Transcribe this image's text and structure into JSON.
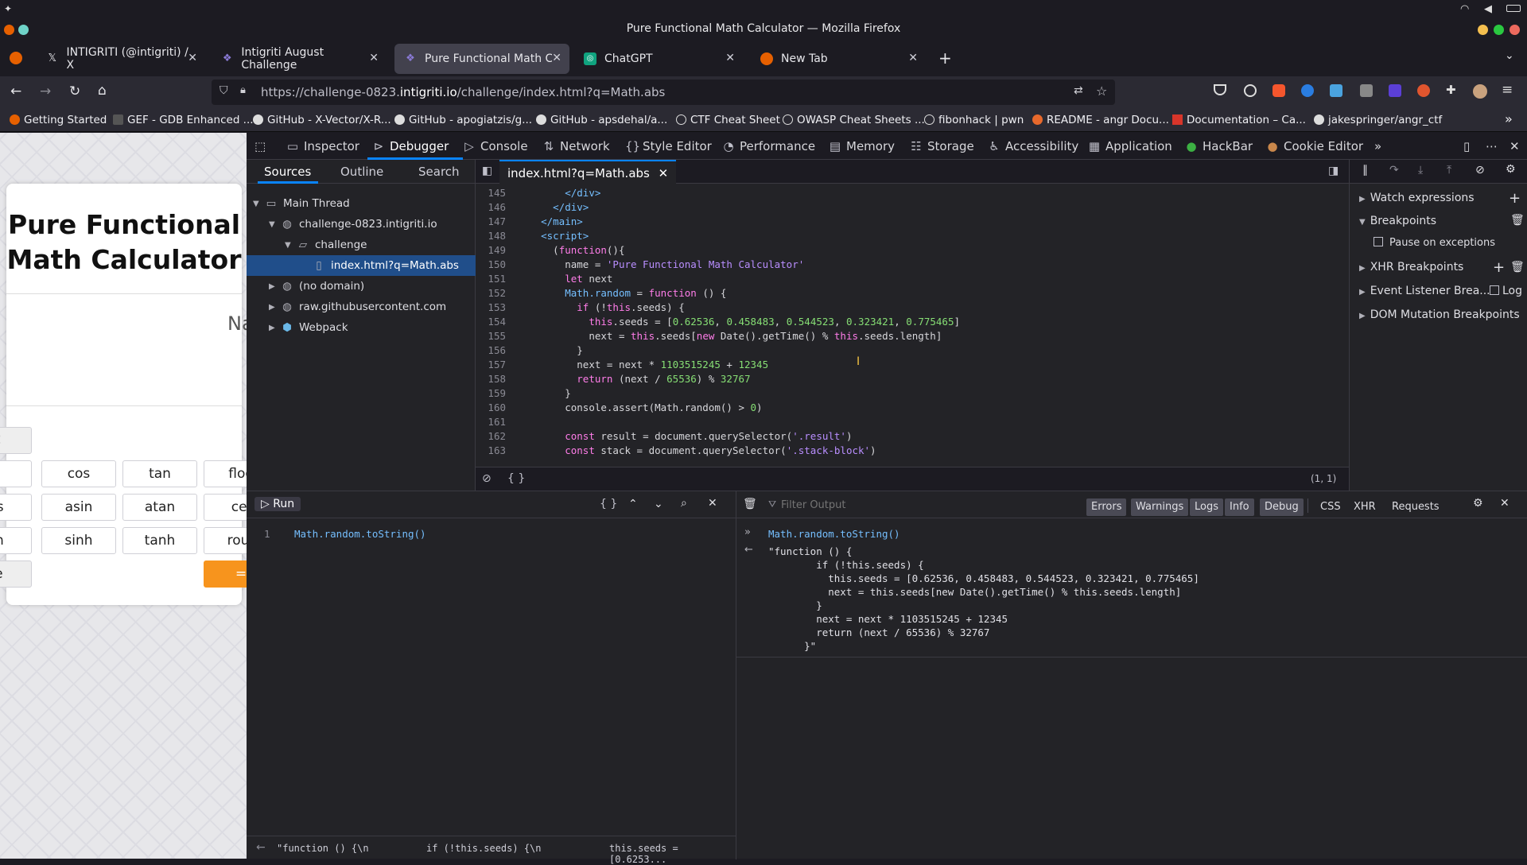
{
  "window": {
    "title": "Pure Functional Math Calculator — Mozilla Firefox"
  },
  "tabs": [
    {
      "label": "INTIGRITI (@intigriti) / X",
      "icon": "x-logo-icon"
    },
    {
      "label": "Intigriti August Challenge",
      "icon": "intigriti-icon"
    },
    {
      "label": "Pure Functional Math Calc",
      "icon": "intigriti-icon",
      "active": true
    },
    {
      "label": "ChatGPT",
      "icon": "chatgpt-icon"
    },
    {
      "label": "New Tab",
      "icon": "firefox-icon"
    }
  ],
  "nav": {
    "url_prefix": "https://challenge-0823.",
    "url_domain": "intigriti.io",
    "url_path": "/challenge/index.html?q=Math.abs"
  },
  "bookmarks": [
    "Getting Started",
    "GEF - GDB Enhanced ...",
    "GitHub - X-Vector/X-R...",
    "GitHub - apogiatzis/g...",
    "GitHub - apsdehal/a...",
    "CTF Cheat Sheet",
    "OWASP Cheat Sheets ...",
    "fibonhack | pwn",
    "README - angr Docu...",
    "Documentation – Ca...",
    "jakespringer/angr_ctf"
  ],
  "page": {
    "title_line1": "Pure Functional",
    "title_line2": "Math Calculator",
    "partial_label": "Na",
    "buttons": [
      [
        "n",
        "cos",
        "tan",
        "floo"
      ],
      [
        "os",
        "asin",
        "atan",
        "cei"
      ],
      [
        "sh",
        "sinh",
        "tanh",
        "rour"
      ]
    ],
    "left_partial": "C",
    "last_left": "re",
    "equals": "="
  },
  "devtools": {
    "tools": [
      "Inspector",
      "Console",
      "Debugger",
      "Network",
      "Style Editor",
      "Performance",
      "Memory",
      "Storage",
      "Accessibility",
      "Application",
      "HackBar",
      "Cookie Editor"
    ],
    "source_tabs": [
      "Sources",
      "Outline",
      "Search"
    ],
    "tree": [
      {
        "label": "Main Thread"
      },
      {
        "label": "challenge-0823.intigriti.io"
      },
      {
        "label": "challenge"
      },
      {
        "label": "index.html?q=Math.abs"
      },
      {
        "label": "(no domain)"
      },
      {
        "label": "raw.githubusercontent.com"
      },
      {
        "label": "Webpack"
      }
    ],
    "editor_tab": "index.html?q=Math.abs",
    "cursor_pos": "(1, 1)",
    "right_pane": {
      "watch": "Watch expressions",
      "breakpoints": "Breakpoints",
      "pause_exceptions": "Pause on exceptions",
      "xhr": "XHR Breakpoints",
      "event_listener": "Event Listener Brea...",
      "log": "Log",
      "dom_mutation": "DOM Mutation Breakpoints"
    },
    "console": {
      "run": "Run",
      "input_line_no": "1",
      "input": "Math.random.toString()",
      "filter_placeholder": "Filter Output",
      "filters": [
        "Errors",
        "Warnings",
        "Logs",
        "Info",
        "Debug",
        "CSS",
        "XHR",
        "Requests"
      ],
      "echo": "Math.random.toString()",
      "output": [
        "\"function () {",
        "        if (!this.seeds) {",
        "          this.seeds = [0.62536, 0.458483, 0.544523, 0.323421, 0.775465]",
        "          next = this.seeds[new Date().getTime() % this.seeds.length]",
        "        }",
        "        next = next * 1103515245 + 12345",
        "        return (next / 65536) % 32767",
        "      }\""
      ],
      "history": [
        "\"function () {\\n",
        "if (!this.seeds) {\\n",
        "this.seeds = [0.6253..."
      ]
    }
  },
  "colors": {
    "accent": "#0a84ff",
    "equals_button": "#f7941d"
  }
}
